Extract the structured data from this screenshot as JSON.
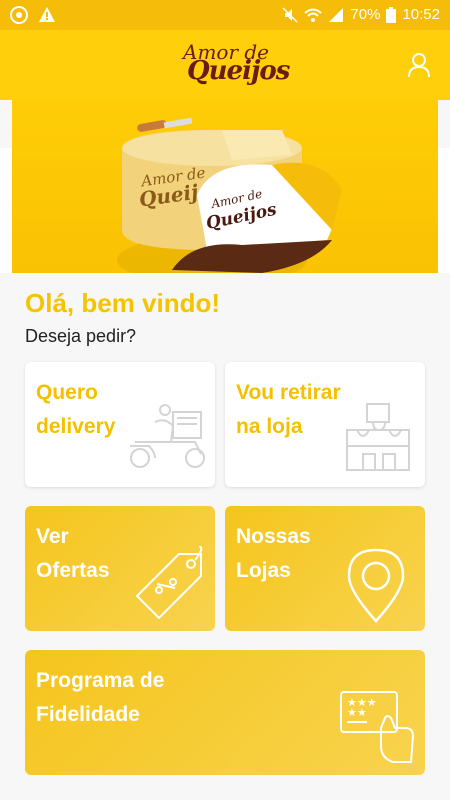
{
  "status_bar": {
    "battery": "70%",
    "time": "10:52"
  },
  "header": {
    "logo_line1": "Amor de",
    "logo_line2": "Queijos"
  },
  "hero": {
    "cheese_text_1": "Amor de",
    "cheese_text_2": "Queijos",
    "cap_text_1": "Amor de",
    "cap_text_2": "Queijos"
  },
  "greeting": {
    "title": "Olá, bem vindo!",
    "subtitle": "Deseja pedir?"
  },
  "cards": [
    {
      "line1": "Quero",
      "line2": "delivery",
      "icon": "delivery-scooter-icon"
    },
    {
      "line1": "Vou retirar",
      "line2": "na loja",
      "icon": "store-pickup-icon"
    },
    {
      "line1": "Ver",
      "line2": "Ofertas",
      "icon": "price-tag-icon"
    },
    {
      "line1": "Nossas",
      "line2": "Lojas",
      "icon": "map-pin-icon"
    },
    {
      "line1": "Programa de",
      "line2": "Fidelidade",
      "icon": "loyalty-card-icon"
    }
  ],
  "colors": {
    "brand_yellow": "#ffcf0b",
    "status_yellow": "#f5bd0a",
    "text_yellow": "#f5c400",
    "logo_brown": "#6a1b12"
  }
}
